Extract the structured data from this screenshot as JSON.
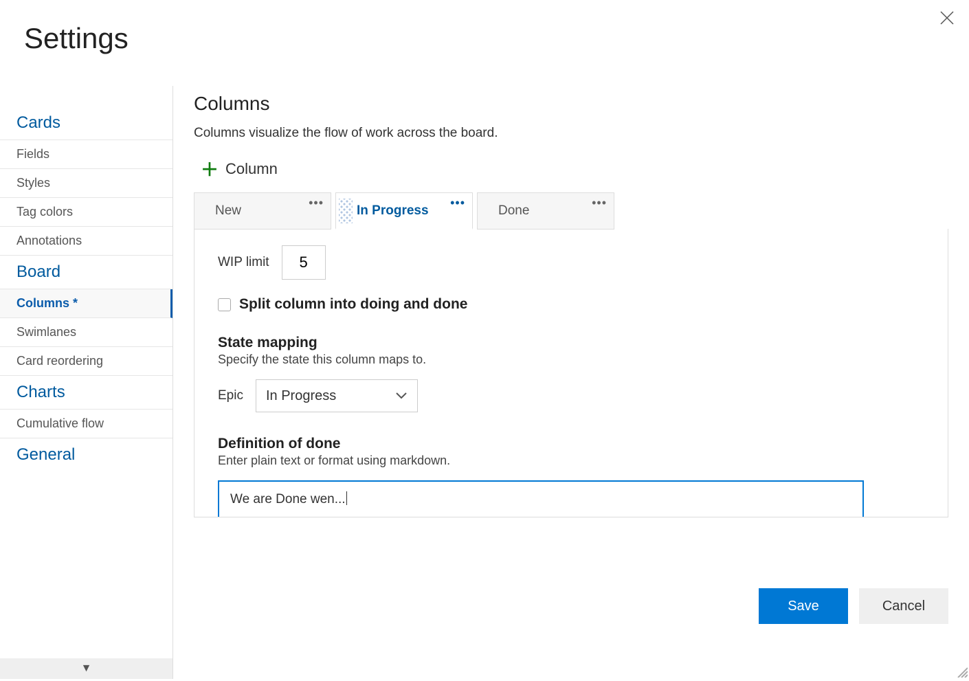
{
  "title": "Settings",
  "sidebar": {
    "sections": [
      {
        "name": "Cards",
        "items": [
          {
            "label": "Fields",
            "key": "fields"
          },
          {
            "label": "Styles",
            "key": "styles"
          },
          {
            "label": "Tag colors",
            "key": "tag-colors"
          },
          {
            "label": "Annotations",
            "key": "annotations"
          }
        ]
      },
      {
        "name": "Board",
        "items": [
          {
            "label": "Columns *",
            "key": "columns",
            "active": true
          },
          {
            "label": "Swimlanes",
            "key": "swimlanes"
          },
          {
            "label": "Card reordering",
            "key": "card-reordering"
          }
        ]
      },
      {
        "name": "Charts",
        "items": [
          {
            "label": "Cumulative flow",
            "key": "cumulative-flow"
          }
        ]
      },
      {
        "name": "General",
        "items": []
      }
    ]
  },
  "panel": {
    "heading": "Columns",
    "description": "Columns visualize the flow of work across the board.",
    "addLabel": "Column",
    "tabs": [
      {
        "label": "New"
      },
      {
        "label": "In Progress",
        "active": true
      },
      {
        "label": "Done"
      }
    ],
    "wip": {
      "label": "WIP limit",
      "value": "5"
    },
    "split": {
      "label": "Split column into doing and done",
      "checked": false
    },
    "stateMapping": {
      "heading": "State mapping",
      "description": "Specify the state this column maps to.",
      "typeLabel": "Epic",
      "selected": "In Progress"
    },
    "dod": {
      "heading": "Definition of done",
      "description": "Enter plain text or format using markdown.",
      "value": "We are Done wen..."
    }
  },
  "footer": {
    "save": "Save",
    "cancel": "Cancel"
  }
}
